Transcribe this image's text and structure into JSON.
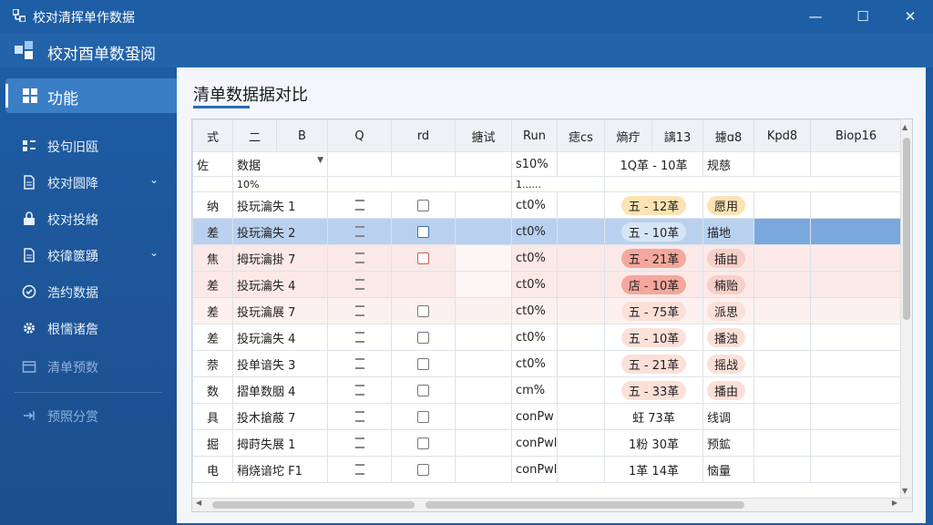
{
  "window": {
    "title": "校对清挥单作数据",
    "minimize": "—",
    "maximize": "☐",
    "close": "✕"
  },
  "subheader": {
    "title": "校对酉单数蛩阅"
  },
  "sidebar": {
    "active": {
      "label": "功能",
      "icon": "grid-icon"
    },
    "items": [
      {
        "label": "投句旧瓯",
        "icon": "list-icon",
        "chevron": false
      },
      {
        "label": "校对圆降",
        "icon": "document-icon",
        "chevron": true
      },
      {
        "label": "校对投絡",
        "icon": "lock-icon",
        "chevron": false
      },
      {
        "label": "校徫篋踴",
        "icon": "document-icon",
        "chevron": true
      },
      {
        "label": "浩约数据",
        "icon": "check-circle-icon",
        "chevron": false
      },
      {
        "label": "根懦诸詹",
        "icon": "gear-icon",
        "chevron": false
      },
      {
        "label": "清单预数",
        "icon": "calendar-icon",
        "chevron": false,
        "dim": true
      },
      {
        "label": "预照分赏",
        "icon": "exit-icon",
        "chevron": false,
        "dim": true
      }
    ]
  },
  "main": {
    "heading": "清单数据据对比"
  },
  "table": {
    "headers": [
      "式",
      "二",
      "B",
      "Q",
      "rd",
      "搪试",
      "Run",
      "痣cs",
      "熵疔",
      "謧13",
      "攄ɑ8",
      "Kpd8",
      "Biop16"
    ],
    "filter": {
      "type": "佐",
      "value": "数据",
      "percent": "10%",
      "runv": "s10%",
      "sub": "1......",
      "range": "1Q革 - 10革",
      "tag": "规慈"
    },
    "rows": [
      {
        "a": "纳",
        "name": "投玩瀹失 1",
        "q": "lines",
        "cb": "plain",
        "run": "ct0%",
        "pill1": "五 - 12革",
        "pill2": "愿用",
        "style": "orange"
      },
      {
        "a": "差",
        "name": "投玩瀹失 2",
        "q": "lines",
        "cb": "blue",
        "run": "ct0%",
        "pill1": "五 - 10革",
        "pill2": "描地",
        "style": "sel"
      },
      {
        "a": "焦",
        "name": "拇玩瀹掛 7",
        "q": "lines",
        "cb": "red",
        "run": "ct0%",
        "pill1": "五 - 21革",
        "pill2": "插由",
        "style": "red"
      },
      {
        "a": "差",
        "name": "投玩瀹失 4",
        "q": "lines",
        "cb": "none",
        "run": "ct0%",
        "pill1": "店 - 10革",
        "pill2": "楠贻",
        "style": "red"
      },
      {
        "a": "差",
        "name": "投玩瀹展 7",
        "q": "lines",
        "cb": "plain",
        "run": "ct0%",
        "pill1": "五 - 75革",
        "pill2": "派思",
        "style": "peach"
      },
      {
        "a": "差",
        "name": "投玩瀹失 4",
        "q": "lines",
        "cb": "plain",
        "run": "ct0%",
        "pill1": "五 - 10革",
        "pill2": "播浊",
        "style": "peach"
      },
      {
        "a": "萘",
        "name": "投单谙失 3",
        "q": "lines",
        "cb": "plain",
        "run": "ct0%",
        "pill1": "五 - 21革",
        "pill2": "摇战",
        "style": "peach"
      },
      {
        "a": "数",
        "name": "摺单数胭 4",
        "q": "lines",
        "cb": "plain",
        "run": "cm%",
        "pill1": "五 - 33革",
        "pill2": "播由",
        "style": "peach"
      },
      {
        "a": "具",
        "name": "投木搶蒑 7",
        "q": "lines",
        "cb": "plain",
        "run": "conPw",
        "pill1": "蚟  73革",
        "pill2": "线调",
        "style": "plain"
      },
      {
        "a": "掘",
        "name": "拇莳失展 1",
        "q": "lines",
        "cb": "plain",
        "run": "conPwl",
        "pill1": "1粉  30革",
        "pill2": "预鉱",
        "style": "plain"
      },
      {
        "a": "电",
        "name": "稍烧谙坨 F1",
        "q": "lines",
        "cb": "plain",
        "run": "conPwl",
        "pill1": "1革  14革",
        "pill2": "恼量",
        "style": "plain"
      }
    ]
  }
}
